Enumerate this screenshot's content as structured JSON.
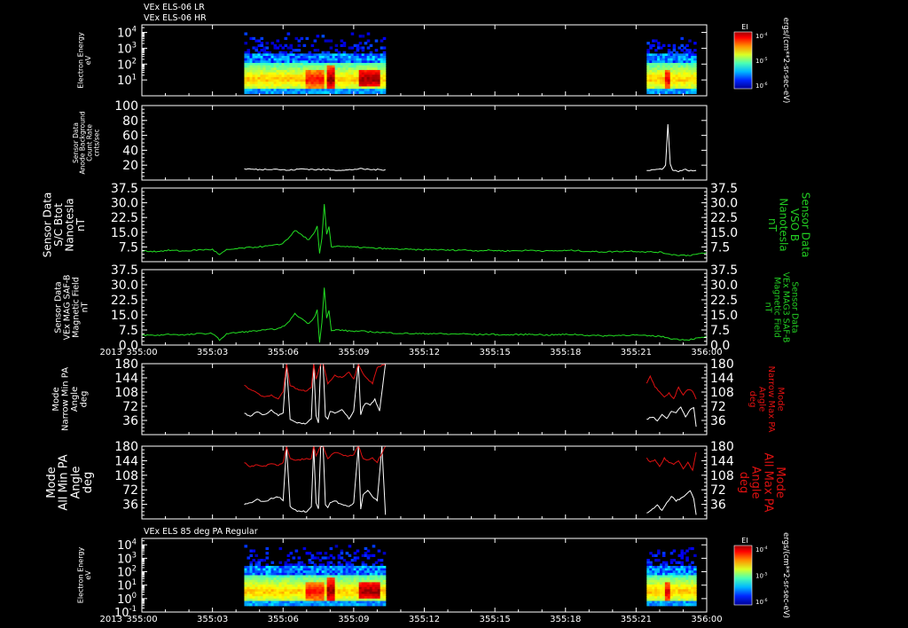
{
  "colors": {
    "background": "#000000",
    "axis": "#ffffff",
    "trace_white": "#ffffff",
    "trace_green": "#22dd22",
    "trace_red": "#dd1111",
    "label_green": "#22cc22",
    "label_red": "#dd1111"
  },
  "chart_data": [
    {
      "type": "heatmap",
      "id": "els-energy-lr-hr",
      "titles": [
        "VEx ELS-06 LR",
        "VEx ELS-06 HR"
      ],
      "ylabel": [
        "Electron Energy",
        "eV"
      ],
      "y_scale": "log",
      "ylim": [
        1,
        30000
      ],
      "y_ticks": [
        {
          "v": 10,
          "label": "10",
          "sup": "1"
        },
        {
          "v": 100,
          "label": "10",
          "sup": "2"
        },
        {
          "v": 1000,
          "label": "10",
          "sup": "3"
        },
        {
          "v": 10000,
          "label": "10",
          "sup": "4"
        }
      ],
      "colorbar": {
        "title": "EI",
        "units": "ergs/(cm**2-sr-sec-eV)",
        "ticks": [
          {
            "label": "10",
            "sup": "-4"
          },
          {
            "label": "10",
            "sup": "-5"
          },
          {
            "label": "10",
            "sup": "-6"
          }
        ]
      },
      "data_intervals": [
        [
          4.35,
          10.35
        ],
        [
          21.45,
          23.55
        ]
      ]
    },
    {
      "type": "line",
      "id": "anode-background",
      "ylabel": [
        "Sensor Data",
        "Anode Background",
        "Count Rate",
        "cnts/sec"
      ],
      "ylim": [
        0,
        100
      ],
      "y_ticks": [
        20,
        40,
        60,
        80,
        100
      ],
      "series": [
        {
          "color": "white",
          "segments": [
            {
              "x": [
                4.35,
                5.0,
                5.6,
                6.2,
                6.8,
                7.4,
                8.0,
                8.6,
                9.2,
                9.8,
                10.35
              ],
              "y": [
                15,
                14,
                15,
                13,
                15,
                14,
                14,
                13,
                15,
                14,
                14
              ]
            },
            {
              "x": [
                21.45,
                21.8,
                22.1,
                22.25,
                22.35,
                22.45,
                22.55,
                22.8,
                23.1,
                23.4,
                23.55
              ],
              "y": [
                13,
                14,
                15,
                20,
                75,
                22,
                13,
                12,
                14,
                12,
                13
              ]
            }
          ]
        }
      ]
    },
    {
      "type": "line",
      "id": "btot",
      "ylabel": [
        "Sensor Data",
        "S/C Btot",
        "Nanotesla",
        "nT"
      ],
      "ylabel_right": [
        "Sensor Data",
        "VSO B",
        "Nanotesla",
        "nT"
      ],
      "ylim": [
        0,
        37.5
      ],
      "y_ticks": [
        7.5,
        15.0,
        22.5,
        30.0,
        37.5
      ],
      "series": [
        {
          "color": "green",
          "segments": [
            {
              "x": [
                0,
                0.6,
                1.2,
                1.8,
                2.4,
                3.0,
                3.3,
                3.6,
                4.2,
                4.8,
                5.4,
                5.9,
                6.2,
                6.5,
                6.8,
                7.1,
                7.35,
                7.45,
                7.55,
                7.65,
                7.75,
                7.85,
                7.95,
                8.05,
                8.3,
                8.8,
                9.4,
                10.0,
                10.6,
                11.2,
                11.8,
                12.4,
                13.0,
                13.6,
                14.2,
                14.8,
                15.4,
                16.0,
                16.6,
                17.2,
                17.8,
                18.4,
                19.0,
                19.6,
                20.2,
                20.8,
                21.4,
                22.0,
                22.6,
                23.2,
                23.6,
                24.0
              ],
              "y": [
                5.5,
                5.2,
                5.8,
                5.4,
                6.0,
                6.2,
                3.5,
                6.0,
                6.8,
                7.4,
                8.0,
                8.8,
                11.5,
                16.0,
                13.5,
                11.0,
                15.0,
                18.0,
                4.0,
                12.0,
                29.0,
                14.0,
                18.0,
                7.5,
                8.0,
                7.5,
                7.2,
                6.8,
                6.5,
                6.3,
                6.0,
                6.2,
                5.8,
                6.0,
                5.6,
                5.8,
                5.5,
                5.6,
                5.8,
                5.4,
                5.6,
                5.7,
                5.2,
                5.0,
                5.2,
                5.4,
                5.0,
                4.8,
                3.5,
                3.2,
                3.8,
                4.5
              ]
            }
          ]
        }
      ]
    },
    {
      "type": "line",
      "id": "mag-saf-b",
      "ylabel": [
        "Sensor Data",
        "VEx MAG SAF-B",
        "Magnetic Field",
        "nT"
      ],
      "ylabel_right": [
        "Sensor Data",
        "VEx MAG3 SAF-B",
        "Magnetic Field",
        "nT"
      ],
      "ylim": [
        0,
        37.5
      ],
      "y_ticks": [
        0.0,
        7.5,
        15.0,
        22.5,
        30.0,
        37.5
      ],
      "series": [
        {
          "color": "green",
          "segments": [
            {
              "x": [
                0,
                0.6,
                1.2,
                1.8,
                2.4,
                3.0,
                3.3,
                3.6,
                4.2,
                4.8,
                5.4,
                5.9,
                6.2,
                6.5,
                6.8,
                7.1,
                7.35,
                7.45,
                7.55,
                7.65,
                7.75,
                7.85,
                7.95,
                8.05,
                8.3,
                8.8,
                9.4,
                10.0,
                10.6,
                11.2,
                11.8,
                12.4,
                13.0,
                13.6,
                14.2,
                14.8,
                15.4,
                16.0,
                16.6,
                17.2,
                17.8,
                18.4,
                19.0,
                19.6,
                20.2,
                20.8,
                21.4,
                22.0,
                22.6,
                23.2,
                23.6,
                24.0
              ],
              "y": [
                5.0,
                4.8,
                5.4,
                5.0,
                5.6,
                5.8,
                2.5,
                5.6,
                6.4,
                7.0,
                7.6,
                8.4,
                11.0,
                15.5,
                13.0,
                10.5,
                14.5,
                17.5,
                1.5,
                11.5,
                28.5,
                13.5,
                17.0,
                7.0,
                7.6,
                7.0,
                6.8,
                6.4,
                6.0,
                5.8,
                5.6,
                5.8,
                5.4,
                5.6,
                5.2,
                5.4,
                5.0,
                5.2,
                5.4,
                5.0,
                5.2,
                5.3,
                4.8,
                4.6,
                4.8,
                5.0,
                4.6,
                4.4,
                3.0,
                2.6,
                3.4,
                4.0
              ]
            }
          ]
        }
      ]
    },
    {
      "type": "line",
      "id": "narrow-pa",
      "ylabel": [
        "Mode",
        "Narrow Min PA",
        "Angle",
        "deg"
      ],
      "ylabel_right": [
        "Mode",
        "Narrow Max PA",
        "Angle",
        "deg"
      ],
      "ylim": [
        0,
        180
      ],
      "y_ticks": [
        36,
        72,
        108,
        144,
        180
      ],
      "series": [
        {
          "color": "white",
          "segments": [
            {
              "x": [
                4.35,
                4.6,
                4.9,
                5.2,
                5.5,
                5.8,
                6.0,
                6.15,
                6.3,
                6.6,
                7.0,
                7.2,
                7.3,
                7.4,
                7.5,
                7.6,
                7.7,
                7.8,
                7.9,
                8.0,
                8.2,
                8.5,
                8.8,
                9.0,
                9.2,
                9.3,
                9.4,
                9.5,
                9.7,
                9.9,
                10.1,
                10.35
              ],
              "y": [
                55,
                45,
                58,
                50,
                62,
                48,
                55,
                180,
                40,
                30,
                28,
                40,
                180,
                48,
                30,
                180,
                180,
                45,
                40,
                60,
                55,
                65,
                40,
                60,
                180,
                50,
                70,
                80,
                75,
                90,
                60,
                180
              ]
            },
            {
              "x": [
                21.45,
                21.7,
                21.9,
                22.1,
                22.3,
                22.5,
                22.7,
                22.9,
                23.1,
                23.3,
                23.45,
                23.55
              ],
              "y": [
                40,
                45,
                35,
                50,
                40,
                60,
                55,
                70,
                45,
                65,
                70,
                20
              ]
            }
          ]
        },
        {
          "color": "red",
          "segments": [
            {
              "x": [
                4.35,
                4.6,
                4.9,
                5.2,
                5.5,
                5.8,
                6.0,
                6.15,
                6.3,
                6.6,
                7.0,
                7.2,
                7.3,
                7.4,
                7.6,
                7.7,
                7.9,
                8.2,
                8.5,
                8.8,
                9.0,
                9.2,
                9.4,
                9.6,
                9.8,
                10.0,
                10.35
              ],
              "y": [
                125,
                115,
                105,
                95,
                100,
                90,
                110,
                180,
                125,
                115,
                110,
                120,
                180,
                140,
                180,
                180,
                130,
                150,
                145,
                160,
                140,
                180,
                155,
                140,
                130,
                170,
                180
              ]
            },
            {
              "x": [
                21.45,
                21.6,
                21.8,
                22.0,
                22.2,
                22.4,
                22.6,
                22.8,
                23.0,
                23.2,
                23.4,
                23.55
              ],
              "y": [
                130,
                150,
                120,
                110,
                95,
                105,
                90,
                120,
                100,
                115,
                110,
                90
              ]
            }
          ]
        }
      ]
    },
    {
      "type": "line",
      "id": "all-pa",
      "ylabel": [
        "Mode",
        "All Min PA",
        "Angle",
        "deg"
      ],
      "ylabel_right": [
        "Mode",
        "All Max PA",
        "Angle",
        "deg"
      ],
      "ylim": [
        0,
        180
      ],
      "y_ticks": [
        36,
        72,
        108,
        144,
        180
      ],
      "series": [
        {
          "color": "white",
          "segments": [
            {
              "x": [
                4.35,
                4.6,
                4.9,
                5.2,
                5.5,
                5.8,
                6.0,
                6.15,
                6.3,
                6.6,
                7.0,
                7.2,
                7.3,
                7.4,
                7.5,
                7.6,
                7.7,
                7.8,
                7.9,
                8.0,
                8.2,
                8.5,
                8.8,
                9.0,
                9.2,
                9.3,
                9.4,
                9.6,
                9.8,
                10.0,
                10.2,
                10.35
              ],
              "y": [
                35,
                40,
                48,
                42,
                50,
                55,
                45,
                180,
                30,
                20,
                18,
                30,
                180,
                40,
                25,
                180,
                180,
                35,
                28,
                40,
                45,
                35,
                30,
                40,
                180,
                25,
                60,
                70,
                55,
                45,
                180,
                10
              ]
            },
            {
              "x": [
                21.45,
                21.7,
                21.9,
                22.1,
                22.3,
                22.5,
                22.7,
                22.9,
                23.1,
                23.3,
                23.45,
                23.55
              ],
              "y": [
                15,
                25,
                35,
                20,
                40,
                55,
                45,
                50,
                60,
                70,
                50,
                10
              ]
            }
          ]
        },
        {
          "color": "red",
          "segments": [
            {
              "x": [
                4.35,
                4.6,
                4.9,
                5.2,
                5.5,
                5.8,
                6.0,
                6.15,
                6.3,
                6.6,
                7.0,
                7.2,
                7.3,
                7.4,
                7.6,
                7.7,
                7.9,
                8.2,
                8.5,
                8.8,
                9.0,
                9.2,
                9.4,
                9.6,
                9.8,
                10.0,
                10.35
              ],
              "y": [
                140,
                128,
                135,
                130,
                138,
                132,
                140,
                180,
                150,
                145,
                150,
                148,
                180,
                155,
                180,
                180,
                150,
                165,
                158,
                155,
                160,
                180,
                150,
                145,
                150,
                140,
                180
              ]
            },
            {
              "x": [
                21.45,
                21.6,
                21.8,
                22.0,
                22.2,
                22.4,
                22.6,
                22.8,
                23.0,
                23.2,
                23.4,
                23.55
              ],
              "y": [
                150,
                140,
                145,
                130,
                150,
                140,
                135,
                145,
                125,
                140,
                120,
                165
              ]
            }
          ]
        }
      ]
    },
    {
      "type": "heatmap",
      "id": "els-85deg-pa",
      "titles": [
        "VEx ELS 85 deg PA Regular"
      ],
      "ylabel": [
        "Electron Energy",
        "eV"
      ],
      "y_scale": "log",
      "ylim": [
        0.1,
        30000
      ],
      "y_ticks": [
        {
          "v": 0.1,
          "label": "10",
          "sup": "-1"
        },
        {
          "v": 1,
          "label": "10",
          "sup": "0"
        },
        {
          "v": 10,
          "label": "10",
          "sup": "1"
        },
        {
          "v": 100,
          "label": "10",
          "sup": "2"
        },
        {
          "v": 1000,
          "label": "10",
          "sup": "3"
        },
        {
          "v": 10000,
          "label": "10",
          "sup": "4"
        }
      ],
      "colorbar": {
        "title": "EI",
        "units": "ergs/(cm**2-sr-sec-eV)",
        "ticks": [
          {
            "label": "10",
            "sup": "-4"
          },
          {
            "label": "10",
            "sup": "-5"
          },
          {
            "label": "10",
            "sup": "-6"
          }
        ]
      },
      "data_intervals": [
        [
          4.35,
          10.35
        ],
        [
          21.45,
          23.55
        ]
      ]
    }
  ],
  "x_axis": {
    "xlim": [
      0,
      24
    ],
    "ticks": [
      {
        "v": 0,
        "label": "355:00"
      },
      {
        "v": 3,
        "label": "355:03"
      },
      {
        "v": 6,
        "label": "355:06"
      },
      {
        "v": 9,
        "label": "355:09"
      },
      {
        "v": 12,
        "label": "355:12"
      },
      {
        "v": 15,
        "label": "355:15"
      },
      {
        "v": 18,
        "label": "355:18"
      },
      {
        "v": 21,
        "label": "355:21"
      },
      {
        "v": 24,
        "label": "356:00"
      }
    ],
    "year": "2013"
  }
}
